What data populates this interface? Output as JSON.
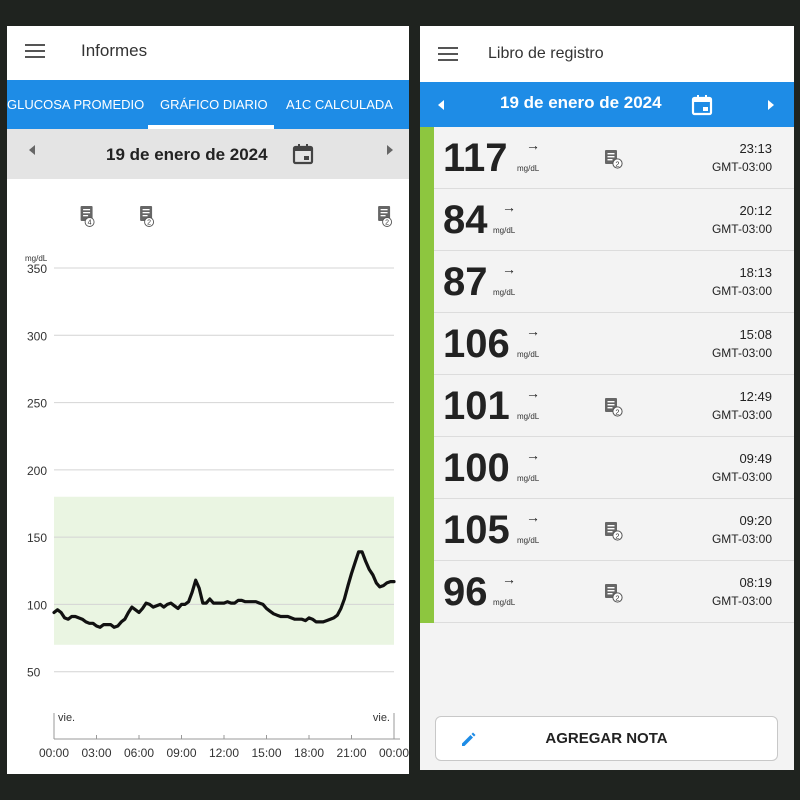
{
  "left": {
    "title": "Informes",
    "tabs": [
      "GLUCOSA PROMEDIO",
      "GRÁFICO DIARIO",
      "A1C CALCULADA"
    ],
    "active_tab": "GRÁFICO DIARIO",
    "date": "19 de enero de 2024",
    "note_badges": [
      "4",
      "2",
      "2"
    ]
  },
  "chart_data": {
    "type": "line",
    "ylabel": "mg/dL",
    "yticks": [
      50,
      100,
      150,
      200,
      250,
      300,
      350
    ],
    "ylim": [
      0,
      350
    ],
    "xticks": [
      "00:00",
      "03:00",
      "06:00",
      "09:00",
      "12:00",
      "15:00",
      "18:00",
      "21:00",
      "00:00"
    ],
    "day_labels": [
      "vie.",
      "vie."
    ],
    "target_range": [
      70,
      180
    ],
    "target_color": "#eaf5e2",
    "line_color": "#111111",
    "series": [
      {
        "x": [
          0,
          0.25,
          0.5,
          0.75,
          1,
          1.25,
          1.5,
          1.75,
          2,
          2.25,
          2.5,
          2.75,
          3,
          3.25,
          3.5,
          3.75,
          4,
          4.25,
          4.5,
          4.75,
          5,
          5.25,
          5.5,
          5.75,
          6,
          6.25,
          6.5,
          6.75,
          7,
          7.25,
          7.5,
          7.75,
          8,
          8.25,
          8.5,
          8.75,
          9,
          9.25,
          9.5,
          9.75,
          10,
          10.25,
          10.5,
          10.75,
          11,
          11.25,
          11.5,
          11.75,
          12,
          12.25,
          12.5,
          12.75,
          13,
          13.25,
          13.5,
          13.75,
          14,
          14.25,
          14.5,
          14.75,
          15,
          15.25,
          15.5,
          15.75,
          16,
          16.25,
          16.5,
          16.75,
          17,
          17.25,
          17.5,
          17.75,
          18,
          18.25,
          18.5,
          18.75,
          19,
          19.25,
          19.5,
          19.75,
          20,
          20.25,
          20.5,
          20.75,
          21,
          21.25,
          21.5,
          21.75,
          22,
          22.25,
          22.5,
          22.75,
          23,
          23.25,
          23.5,
          23.75,
          24
        ],
        "y": [
          94,
          96,
          94,
          90,
          89,
          91,
          91,
          90,
          89,
          87,
          86,
          86,
          84,
          83,
          85,
          85,
          85,
          83,
          84,
          87,
          89,
          94,
          98,
          96,
          94,
          97,
          101,
          100,
          98,
          99,
          100,
          98,
          100,
          101,
          99,
          97,
          100,
          100,
          102,
          109,
          118,
          112,
          101,
          101,
          104,
          101,
          101,
          101,
          101,
          102,
          101,
          101,
          103,
          103,
          102,
          102,
          102,
          102,
          101,
          100,
          97,
          95,
          93,
          92,
          91,
          91,
          91,
          90,
          89,
          89,
          89,
          88,
          90,
          89,
          87,
          87,
          87,
          88,
          89,
          90,
          92,
          97,
          104,
          114,
          123,
          131,
          139,
          139,
          132,
          126,
          122,
          116,
          113,
          114,
          116,
          117,
          117
        ]
      }
    ]
  },
  "right": {
    "title": "Libro de registro",
    "date": "19 de enero de 2024",
    "unit": "mg/dL",
    "trend_arrow": "→",
    "readings": [
      {
        "value": "117",
        "time": "23:13",
        "tz": "GMT-03:00",
        "note": "2"
      },
      {
        "value": "84",
        "time": "20:12",
        "tz": "GMT-03:00",
        "note": ""
      },
      {
        "value": "87",
        "time": "18:13",
        "tz": "GMT-03:00",
        "note": ""
      },
      {
        "value": "106",
        "time": "15:08",
        "tz": "GMT-03:00",
        "note": ""
      },
      {
        "value": "101",
        "time": "12:49",
        "tz": "GMT-03:00",
        "note": "2"
      },
      {
        "value": "100",
        "time": "09:49",
        "tz": "GMT-03:00",
        "note": ""
      },
      {
        "value": "105",
        "time": "09:20",
        "tz": "GMT-03:00",
        "note": "2"
      },
      {
        "value": "96",
        "time": "08:19",
        "tz": "GMT-03:00",
        "note": "2"
      }
    ],
    "add_note_label": "AGREGAR NOTA"
  },
  "colors": {
    "accent": "#1e8ce6",
    "in_range": "#8dc63f"
  },
  "icons": [
    "menu-icon",
    "calendar-icon",
    "chevron-left-icon",
    "chevron-right-icon",
    "note-icon",
    "arrow-right-icon",
    "pencil-icon"
  ]
}
